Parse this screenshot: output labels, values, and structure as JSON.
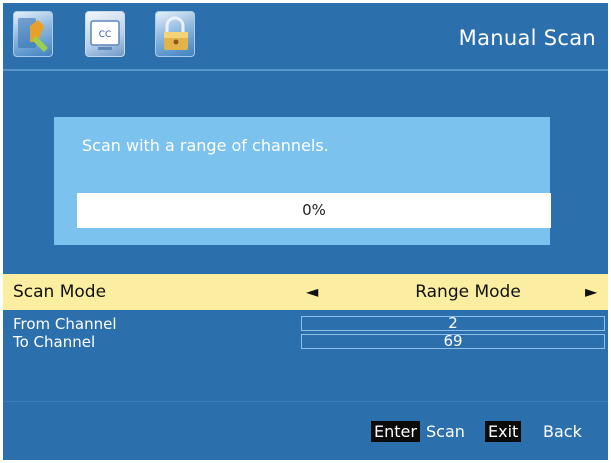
{
  "header": {
    "title": "Manual Scan",
    "tabs": [
      {
        "icon": "picture-icon"
      },
      {
        "icon": "closed-caption-icon",
        "text": "CC"
      },
      {
        "icon": "lock-icon"
      }
    ]
  },
  "progress": {
    "description": "Scan with a range of channels.",
    "value_percent": 0,
    "text": "0%"
  },
  "scan_mode": {
    "label": "Scan Mode",
    "value": "Range Mode",
    "left_arrow": "◄",
    "right_arrow": "►"
  },
  "from_channel": {
    "label": "From Channel",
    "value": "2"
  },
  "to_channel": {
    "label": "To Channel",
    "value": "69"
  },
  "footer": {
    "enter_key": "Enter",
    "enter_action": "Scan",
    "exit_key": "Exit",
    "exit_action": "Back"
  },
  "colors": {
    "background": "#2c6fad",
    "progress_box": "#7bc2ee",
    "highlight_row": "#fbeea0",
    "key_background": "#0b0b0b"
  }
}
